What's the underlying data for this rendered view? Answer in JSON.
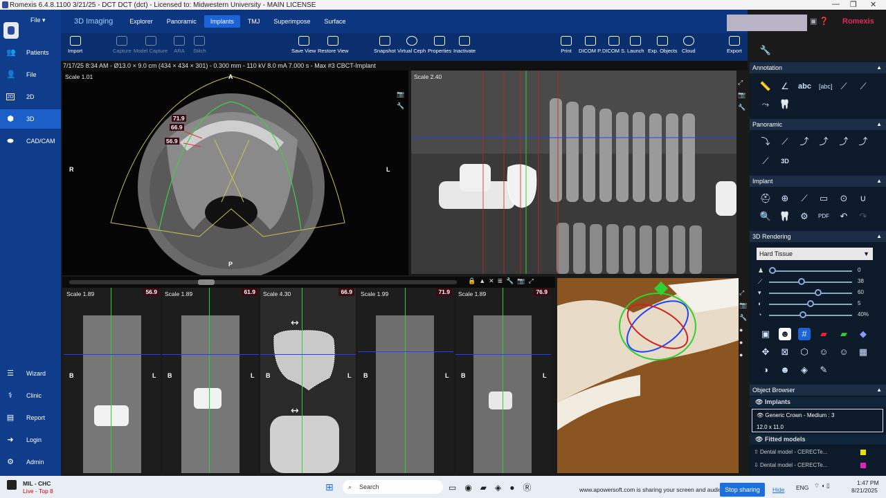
{
  "window": {
    "title": "Romexis 6.4.8.1100 3/21/25 - DCT DCT (dct) - Licensed to: Midwestern University - MAIN LICENSE",
    "controls": [
      "—",
      "❐",
      "✕"
    ]
  },
  "leftnav": {
    "file_menu": "File",
    "items": [
      {
        "label": "Patients"
      },
      {
        "label": "File"
      },
      {
        "label": "2D"
      },
      {
        "label": "3D"
      },
      {
        "label": "CAD/CAM"
      },
      {
        "label": "Wizard"
      },
      {
        "label": "Clinic"
      },
      {
        "label": "Report"
      },
      {
        "label": "Login"
      },
      {
        "label": "Admin"
      }
    ]
  },
  "menubar": {
    "module": "3D Imaging",
    "tabs": [
      "Explorer",
      "Panoramic",
      "Implants",
      "TMJ",
      "Superimpose",
      "Surface"
    ],
    "active_tab": "Implants",
    "brand": "Romexis"
  },
  "toolbar": {
    "buttons": [
      {
        "label": "Import"
      },
      {
        "label": "Capture"
      },
      {
        "label": "Model Capture"
      },
      {
        "label": "ARA"
      },
      {
        "label": "Stitch"
      },
      {
        "label": "Save View"
      },
      {
        "label": "Restore View"
      },
      {
        "label": "Snapshot"
      },
      {
        "label": "Virtual Ceph"
      },
      {
        "label": "Properties"
      },
      {
        "label": "Inactivate"
      },
      {
        "label": "Print"
      },
      {
        "label": "DICOM P."
      },
      {
        "label": "DICOM S."
      },
      {
        "label": "Launch"
      },
      {
        "label": "Exp. Objects"
      },
      {
        "label": "Cloud"
      },
      {
        "label": "Export"
      }
    ]
  },
  "info_line": "7/17/25 8:34 AM - Ø13.0 × 9.0 cm (434 × 434 × 301) - 0.300 mm - 110 kV 8.0 mA 7.000 s - Max #3 CBCT-Implant",
  "axial": {
    "scale": "Scale 1.01",
    "orient_top": "A",
    "orient_bottom": "P",
    "orient_left": "R",
    "orient_right": "L",
    "labels": [
      "71.9",
      "66.9",
      "56.9"
    ]
  },
  "panoramic": {
    "scale": "Scale 2.40"
  },
  "cross_sections": [
    {
      "scale": "Scale 1.89",
      "badge": "56.9"
    },
    {
      "scale": "Scale 1.89",
      "badge": "61.9"
    },
    {
      "scale": "Scale 4.30",
      "badge": "66.9"
    },
    {
      "scale": "Scale 1.99",
      "badge": "71.9"
    },
    {
      "scale": "Scale 1.89",
      "badge": "76.9"
    }
  ],
  "cross_orient": {
    "left": "B",
    "right": "L"
  },
  "right_panel": {
    "annotation": "Annotation",
    "panoramic": "Panoramic",
    "implant": "Implant",
    "rendering": "3D Rendering",
    "rendering_preset": "Hard Tissue",
    "sliders": [
      {
        "value": "0",
        "level": 0.0
      },
      {
        "value": "38",
        "level": 0.38
      },
      {
        "value": "60",
        "level": 0.6
      },
      {
        "value": "5",
        "level": 0.5
      },
      {
        "value": "40%",
        "level": 0.4
      }
    ],
    "object_browser": "Object Browser",
    "implants_header": "Implants",
    "implant_item": "Generic Crown - Medium : 3",
    "implant_size": "12.0 x 11.0",
    "fitted_header": "Fitted models",
    "fitted_items": [
      "Dental model - CERECTe...",
      "Dental model - CERECTe..."
    ]
  },
  "taskbar": {
    "user_name": "MIL - CHC",
    "user_status": "Live - Top 8",
    "search_placeholder": "Search",
    "share_text": "www.apowersoft.com is sharing your screen and audio.",
    "stop_sharing": "Stop sharing",
    "hide": "Hide",
    "lang": "ENG",
    "time": "1:47 PM",
    "date": "8/21/2025"
  },
  "colors": {
    "nav_bg": "#103c8c",
    "accent": "#1d63d8",
    "brand": "#e02b5a",
    "green": "#2fd02f",
    "blue": "#2040ff"
  }
}
